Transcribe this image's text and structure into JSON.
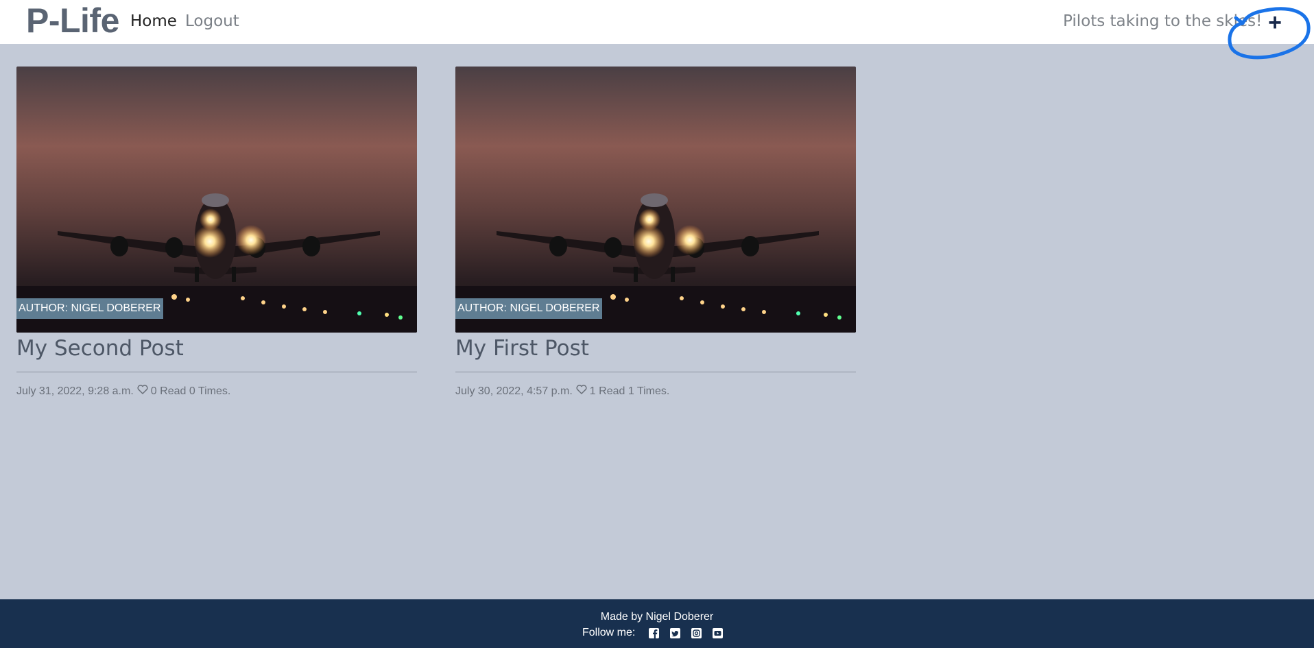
{
  "navbar": {
    "brand": "P-Life",
    "links": [
      {
        "label": "Home"
      },
      {
        "label": "Logout"
      }
    ],
    "tagline": "Pilots taking to the skies!",
    "add_button": {
      "label": "+",
      "icon": "plus-icon"
    }
  },
  "posts": [
    {
      "author": "Author: Nigel Doberer",
      "title": "My Second Post",
      "date": "July 31, 2022, 9:28 a.m.",
      "likes": "0",
      "reads": "Read 0 Times."
    },
    {
      "author": "Author: Nigel Doberer",
      "title": "My First Post",
      "date": "July 30, 2022, 4:57 p.m.",
      "likes": "1",
      "reads": "Read 1 Times."
    }
  ],
  "footer": {
    "made_by": "Made by Nigel Doberer",
    "follow_label": "Follow me:",
    "social_icons": [
      "facebook-icon",
      "twitter-icon",
      "instagram-icon",
      "youtube-icon"
    ]
  },
  "colors": {
    "page_bg": "#c3cad7",
    "footer_bg": "#18304f",
    "badge_bg": "#5f7d92",
    "annotation": "#1a73e8"
  }
}
